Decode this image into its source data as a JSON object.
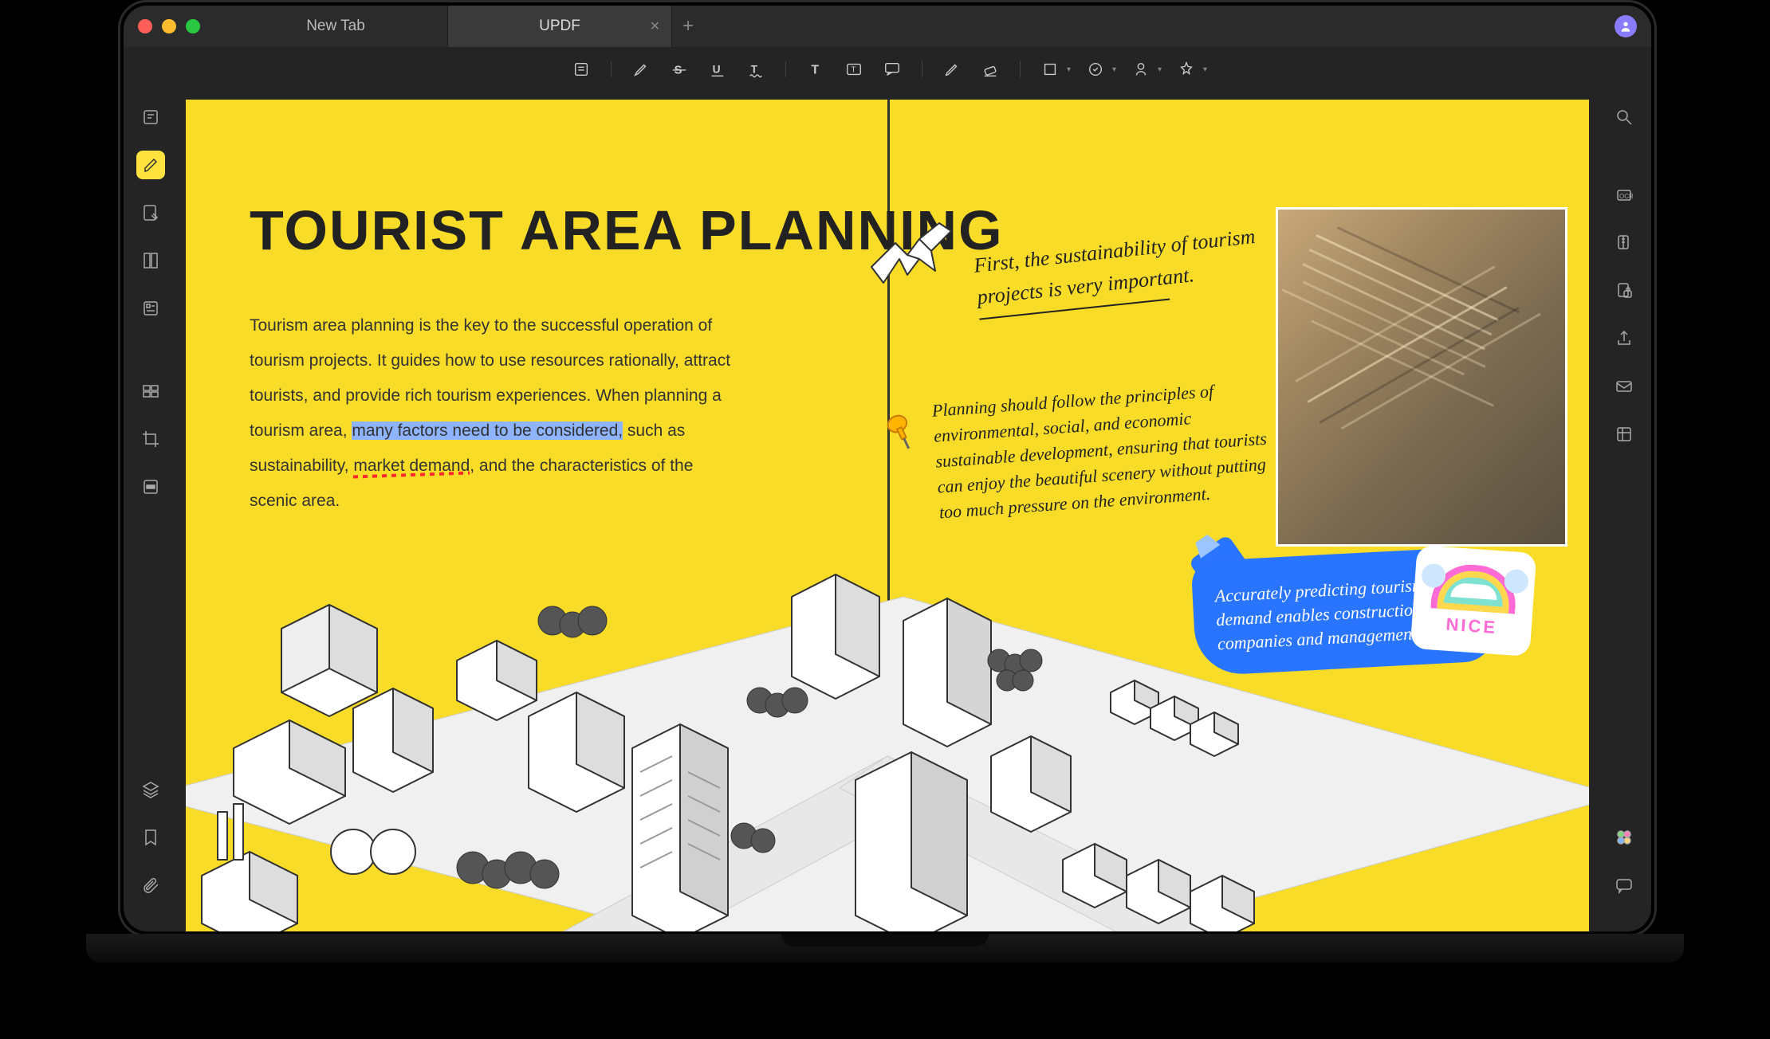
{
  "tabs": {
    "inactive": "New Tab",
    "active": "UPDF"
  },
  "document": {
    "title": "TOURIST AREA PLANNING",
    "para_1": "Tourism area planning is the key to the successful operation of tourism projects.  It guides how to use resources rationally, attract tourists, and provide rich tourism experiences. When planning a tourism area, ",
    "para_hl": "many factors need to be considered,",
    "para_2": " such as sustainability, ",
    "para_sq": "market demand",
    "para_3": ", and the characteristics of the scenic area.",
    "note1": "First, the sustainability of tourism projects is very important.",
    "note2": "Planning should follow the principles of environmental, social, and economic sustainable development, ensuring that tourists can enjoy the beautiful scenery without putting too much pressure on the environment.",
    "bluenote": "Accurately predicting tourism demand enables construction companies and management",
    "sticker": "NICE"
  },
  "colors": {
    "accent": "#8a7cff",
    "highlight": "#8eb4ff",
    "page": "#f8dc28",
    "blue": "#2a75ff"
  },
  "icons": {
    "left": [
      "reader",
      "annotate",
      "edit-text",
      "page-edit",
      "forms",
      "organize",
      "crop",
      "redact"
    ],
    "left_bottom": [
      "layers",
      "bookmark",
      "attachment"
    ],
    "right": [
      "search",
      "ocr",
      "compress",
      "protect",
      "share",
      "email",
      "flatten",
      "convert"
    ],
    "right_bottom": [
      "ai",
      "chat"
    ],
    "toolbar": [
      "note",
      "highlighter",
      "strikethrough",
      "underline",
      "text",
      "insert-text",
      "text-box",
      "text-callout",
      "pencil",
      "eraser",
      "rectangle",
      "stamp",
      "signature",
      "sticker"
    ]
  }
}
